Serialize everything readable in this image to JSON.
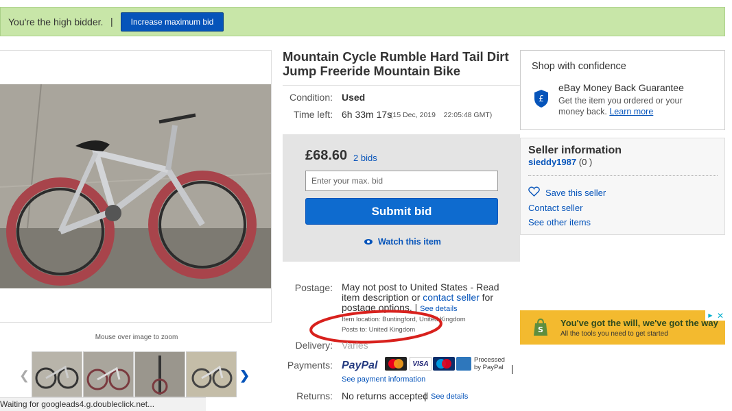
{
  "banner": {
    "message": "You're the high bidder.",
    "separator": "|",
    "button_label": "Increase maximum bid"
  },
  "gallery": {
    "zoom_hint": "Mouse over image to zoom",
    "prev_icon": "chevron-left-icon",
    "next_icon": "chevron-right-icon"
  },
  "browser_status": "Waiting for googleads4.g.doubleclick.net...",
  "item": {
    "title": "Mountain Cycle Rumble Hard Tail Dirt Jump Freeride Mountain Bike",
    "condition_label": "Condition:",
    "condition_value": "Used",
    "time_left_label": "Time left:",
    "time_left_value": "6h 33m 17s",
    "time_left_end": "(15 Dec, 2019    22:05:48 GMT)"
  },
  "bid": {
    "price": "£68.60",
    "bids_link": "2 bids",
    "input_placeholder": "Enter your max. bid",
    "submit_label": "Submit bid",
    "watch_label": "Watch this item"
  },
  "postage": {
    "label": "Postage:",
    "text_1": "May not post to United States - Read item description or",
    "contact_link": "contact seller",
    "text_2": "for postage options.",
    "sep": "|",
    "see_details": "See details",
    "location_line": "Item location:  Buntingford, United Kingdom",
    "posts_to_line": "Posts to:  United Kingdom"
  },
  "delivery": {
    "label": "Delivery:",
    "value": "Varies"
  },
  "payments": {
    "label": "Payments:",
    "paypal": "PayPal",
    "processed_by": "Processed by PayPal",
    "sep": "|",
    "see_payment_info": "See payment information",
    "cards": [
      "MasterCard",
      "VISA",
      "Maestro",
      "Amex"
    ]
  },
  "returns": {
    "label": "Returns:",
    "value": "No returns accepted",
    "sep": "|",
    "see_details": "See details"
  },
  "confidence": {
    "heading": "Shop with confidence",
    "guarantee_title": "eBay Money Back Guarantee",
    "guarantee_text": "Get the item you ordered or your money back.",
    "learn_more": "Learn more",
    "icon": "pound-shield-icon"
  },
  "seller": {
    "heading": "Seller information",
    "username": "sieddy1987",
    "feedback": "(0 )",
    "save_seller": "Save this seller",
    "contact_seller": "Contact seller",
    "other_items": "See other items"
  },
  "ad": {
    "headline": "You've got the will, we've got the way",
    "subline": "All the tools you need to get started"
  },
  "colors": {
    "banner_bg": "#c8e6a8",
    "primary_blue": "#0654ba",
    "annotation_red": "#d8211d",
    "ad_yellow": "#f3ba2f"
  }
}
